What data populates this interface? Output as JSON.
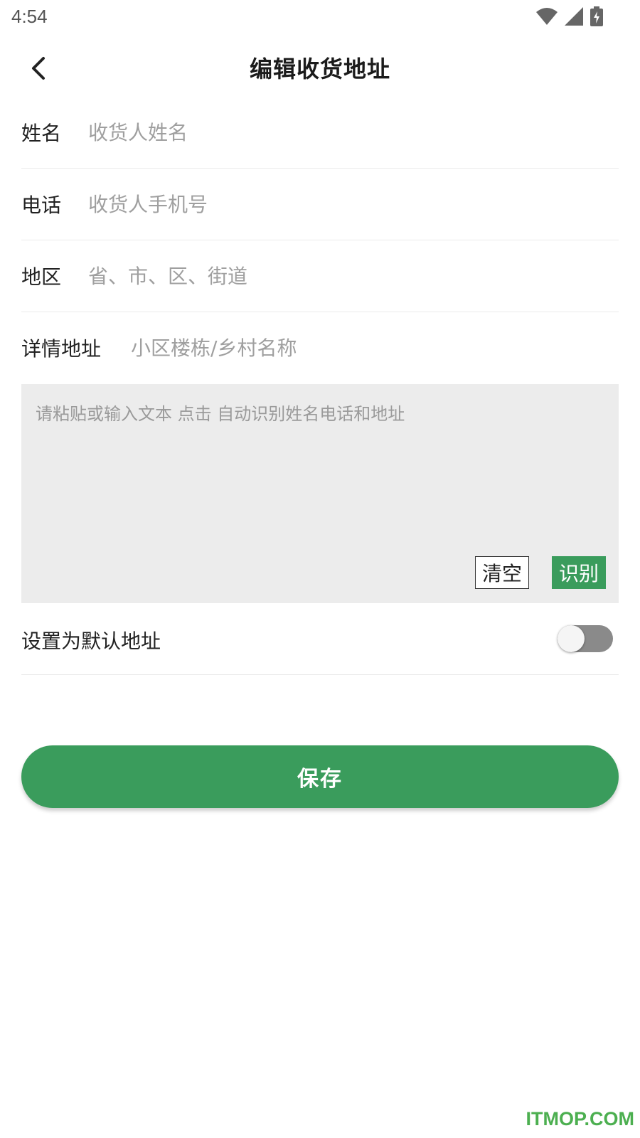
{
  "status_bar": {
    "time": "4:54"
  },
  "header": {
    "title": "编辑收货地址"
  },
  "form": {
    "name": {
      "label": "姓名",
      "placeholder": "收货人姓名",
      "value": ""
    },
    "phone": {
      "label": "电话",
      "placeholder": "收货人手机号",
      "value": ""
    },
    "region": {
      "label": "地区",
      "placeholder": "省、市、区、街道",
      "value": ""
    },
    "detail": {
      "label": "详情地址",
      "placeholder": "小区楼栋/乡村名称",
      "value": ""
    }
  },
  "paste_box": {
    "placeholder": "请粘贴或输入文本 点击 自动识别姓名电话和地址",
    "clear_label": "清空",
    "recognize_label": "识别"
  },
  "default_address": {
    "label": "设置为默认地址",
    "enabled": false
  },
  "save_label": "保存",
  "watermark": "ITMOP.COM",
  "colors": {
    "accent": "#3a9c5c",
    "paste_bg": "#ececec",
    "toggle_off": "#8a8a8a",
    "watermark": "#4caf50"
  },
  "icons": {
    "back": "chevron-left-icon",
    "wifi": "wifi-icon",
    "signal": "cell-signal-icon",
    "battery": "battery-charging-icon"
  }
}
